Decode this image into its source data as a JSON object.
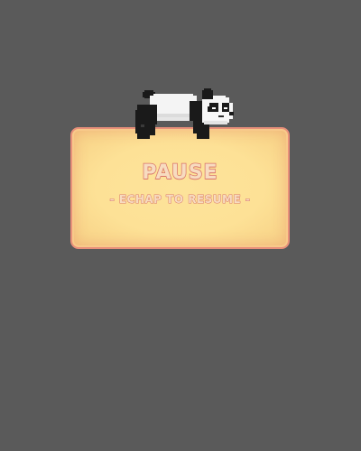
{
  "pause_menu": {
    "title": "PAUSE",
    "hint": "- ECHAP TO RESUME -"
  },
  "mascot": {
    "icon": "sleeping-panda-icon"
  },
  "colors": {
    "background": "#5a5a5a",
    "panel_fill": "#fde196",
    "panel_border": "#e8907a",
    "text_outline": "#d9756a",
    "text_fill": "#f7dcc0"
  }
}
